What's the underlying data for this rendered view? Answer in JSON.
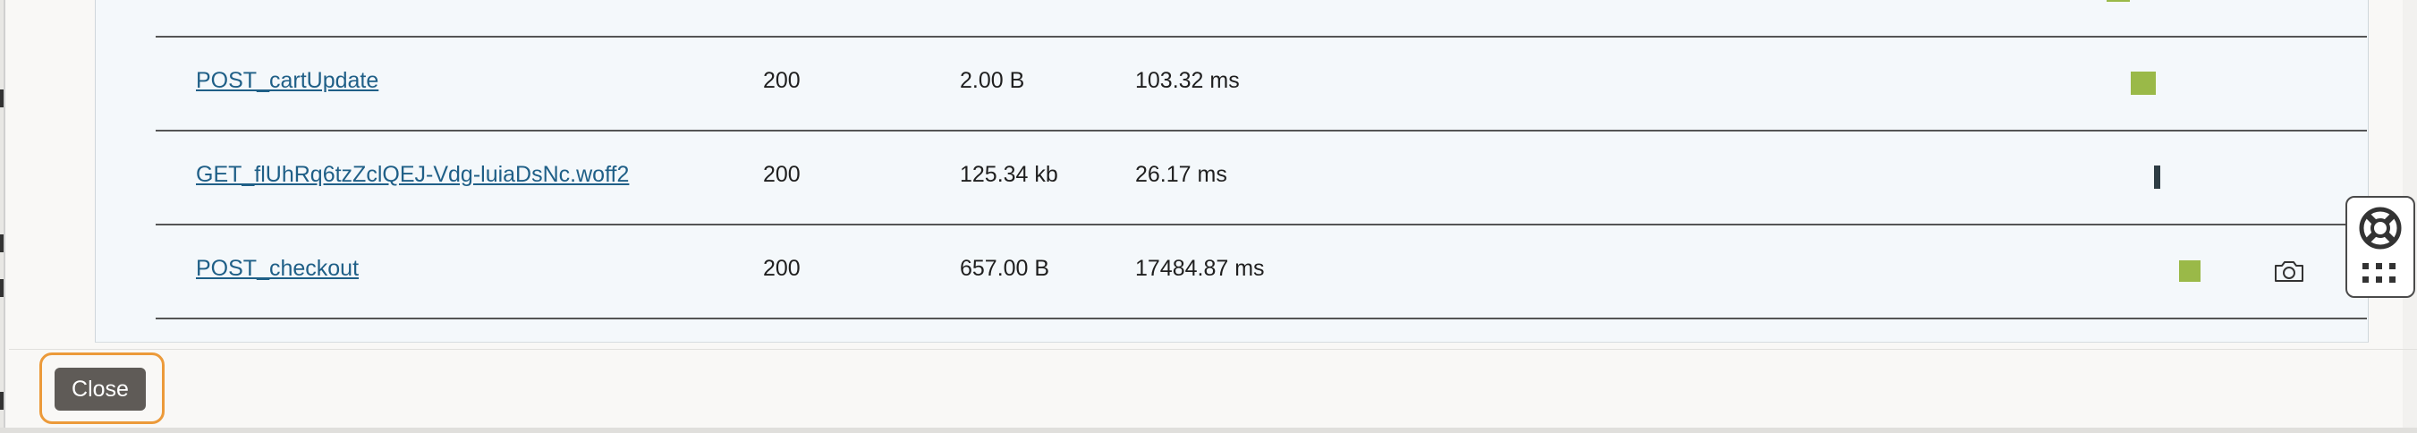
{
  "network_table": {
    "rows": [
      {
        "name": "",
        "status": "",
        "size": "",
        "time": ""
      },
      {
        "name": "POST_cartUpdate",
        "status": "200",
        "size": "2.00 B",
        "time": "103.32 ms"
      },
      {
        "name": "GET_flUhRq6tzZclQEJ-Vdg-luiaDsNc.woff2",
        "status": "200",
        "size": "125.34 kb",
        "time": "26.17 ms"
      },
      {
        "name": "POST_checkout",
        "status": "200",
        "size": "657.00 B",
        "time": "17484.87 ms"
      }
    ]
  },
  "icons": {
    "camera": "camera-icon",
    "help": "lifebuoy-icon",
    "apps": "grid-icon"
  },
  "colors": {
    "bar_green": "#9ab948",
    "bar_dark": "#2e3d44",
    "link": "#1f5f87",
    "focus_ring": "#ec9a3a",
    "close_button_bg": "#5f5b57"
  },
  "footer": {
    "close_label": "Close"
  }
}
